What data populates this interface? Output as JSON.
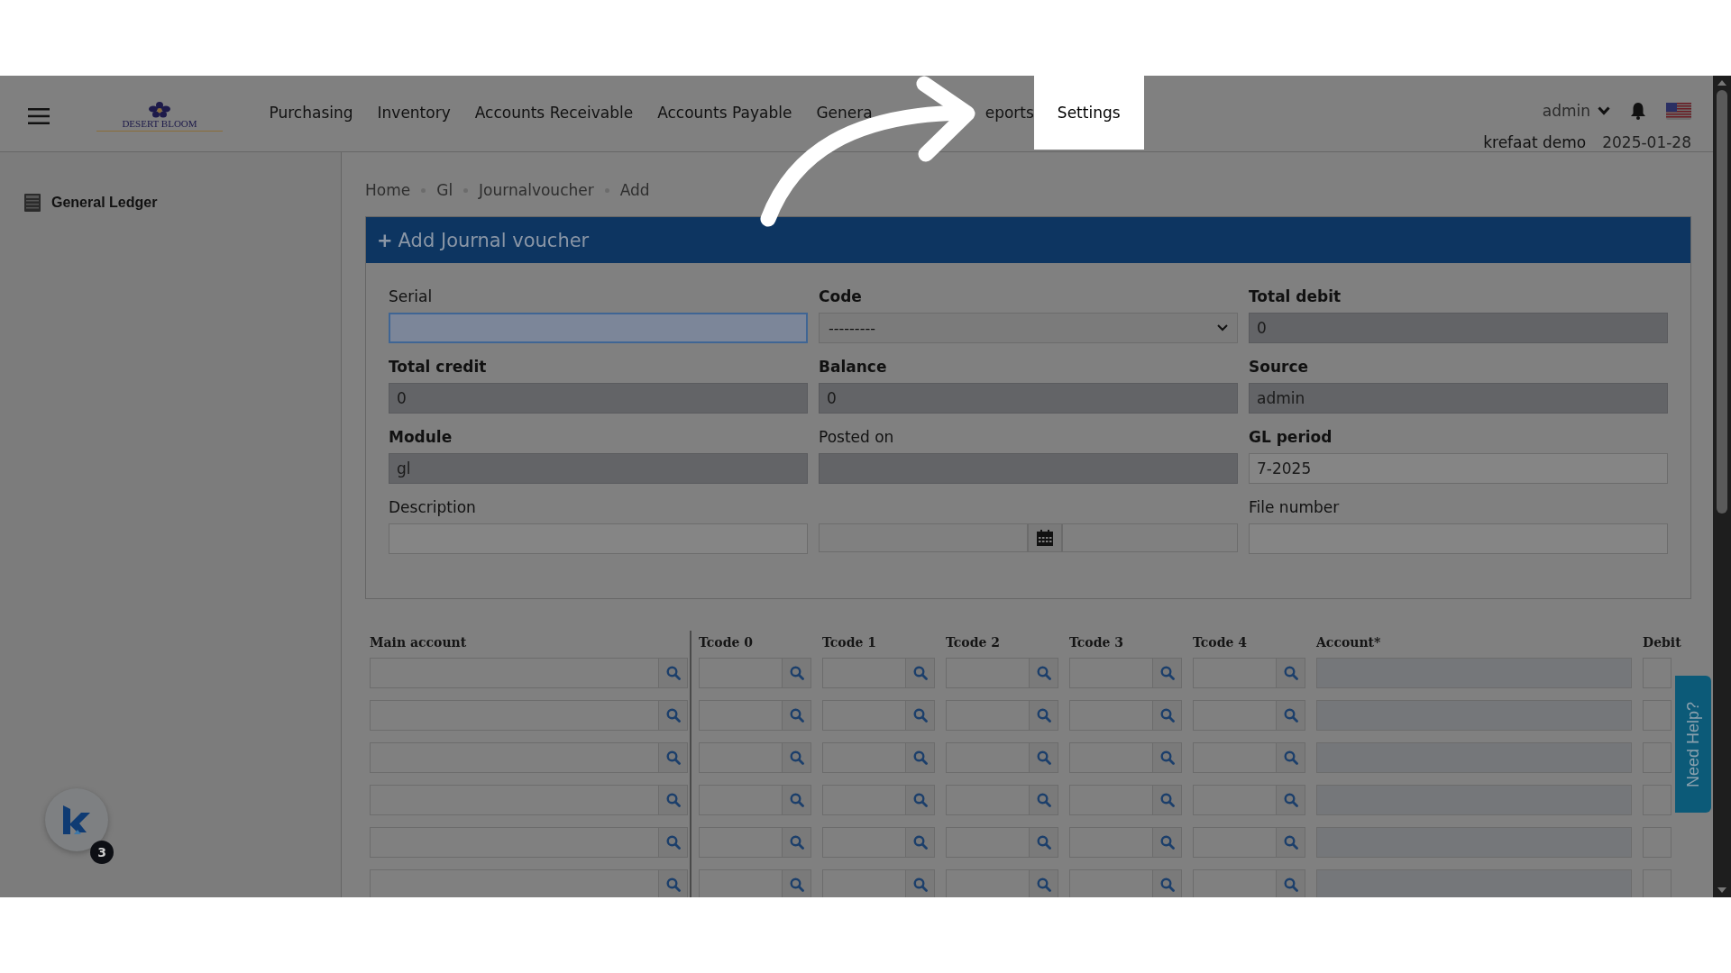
{
  "header": {
    "logo_text": "DESERT BLOOM",
    "nav": [
      {
        "label": "Purchasing",
        "spotlight": false,
        "obscured": false
      },
      {
        "label": "Inventory",
        "spotlight": false,
        "obscured": false
      },
      {
        "label": "Accounts Receivable",
        "spotlight": false,
        "obscured": false
      },
      {
        "label": "Accounts Payable",
        "spotlight": false,
        "obscured": false
      },
      {
        "label": "Genera",
        "spotlight": false,
        "obscured": true
      },
      {
        "label": "eports",
        "spotlight": false,
        "obscured": true
      },
      {
        "label": "Settings",
        "spotlight": true,
        "obscured": false
      }
    ],
    "user": "admin",
    "company": "krefaat demo",
    "date": "2025-01-28"
  },
  "sidebar": {
    "items": [
      {
        "label": "General Ledger"
      }
    ]
  },
  "breadcrumb": [
    "Home",
    "Gl",
    "Journalvoucher",
    "Add"
  ],
  "panel": {
    "title_icon": "+",
    "title": "Add Journal voucher",
    "fields": [
      {
        "kind": "input",
        "label": "Serial",
        "required": false,
        "readonly": false,
        "focused": true
      },
      {
        "kind": "select",
        "label": "Code",
        "required": true,
        "value": "---------"
      },
      {
        "kind": "input",
        "label": "Total debit",
        "required": true,
        "readonly": true,
        "focused": false,
        "value": "0"
      },
      {
        "kind": "input",
        "label": "Total credit",
        "required": true,
        "readonly": true,
        "focused": false,
        "value": "0"
      },
      {
        "kind": "input",
        "label": "Balance",
        "required": true,
        "readonly": true,
        "focused": false,
        "value": "0"
      },
      {
        "kind": "input",
        "label": "Source",
        "required": true,
        "readonly": true,
        "focused": false,
        "value": "admin"
      },
      {
        "kind": "input",
        "label": "Module",
        "required": true,
        "readonly": true,
        "focused": false,
        "value": "gl"
      },
      {
        "kind": "input",
        "label": "Posted on",
        "required": false,
        "readonly": true,
        "focused": false
      },
      {
        "kind": "input",
        "label": "GL period",
        "required": true,
        "readonly": false,
        "focused": false,
        "value": "7-2025"
      },
      {
        "kind": "input",
        "label": "Description",
        "required": false,
        "readonly": false,
        "focused": false
      },
      {
        "kind": "datepicker"
      },
      {
        "kind": "input",
        "label": "File number",
        "required": false,
        "readonly": false,
        "focused": false
      }
    ]
  },
  "table": {
    "columns": [
      {
        "label": "Main account",
        "kind": "main"
      },
      {
        "label": "Tcode 0",
        "kind": "lookup"
      },
      {
        "label": "Tcode 1",
        "kind": "lookup"
      },
      {
        "label": "Tcode 2",
        "kind": "lookup"
      },
      {
        "label": "Tcode 3",
        "kind": "lookup"
      },
      {
        "label": "Tcode 4",
        "kind": "lookup"
      },
      {
        "label": "Account*",
        "kind": "readonly"
      },
      {
        "label": "Debit",
        "kind": "input"
      }
    ]
  },
  "chat_widget": {
    "badge": "3"
  },
  "help_tab": "Need Help?"
}
